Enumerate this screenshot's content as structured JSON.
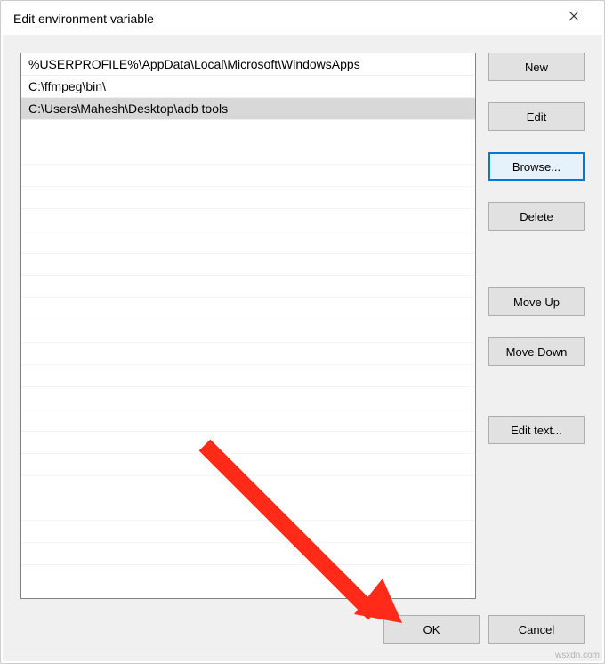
{
  "window": {
    "title": "Edit environment variable"
  },
  "list": {
    "items": [
      "%USERPROFILE%\\AppData\\Local\\Microsoft\\WindowsApps",
      "C:\\ffmpeg\\bin\\",
      "C:\\Users\\Mahesh\\Desktop\\adb tools"
    ],
    "selected_index": 2
  },
  "buttons": {
    "new": "New",
    "edit": "Edit",
    "browse": "Browse...",
    "delete": "Delete",
    "move_up": "Move Up",
    "move_down": "Move Down",
    "edit_text": "Edit text...",
    "ok": "OK",
    "cancel": "Cancel"
  },
  "watermark": "wsxdn.com"
}
